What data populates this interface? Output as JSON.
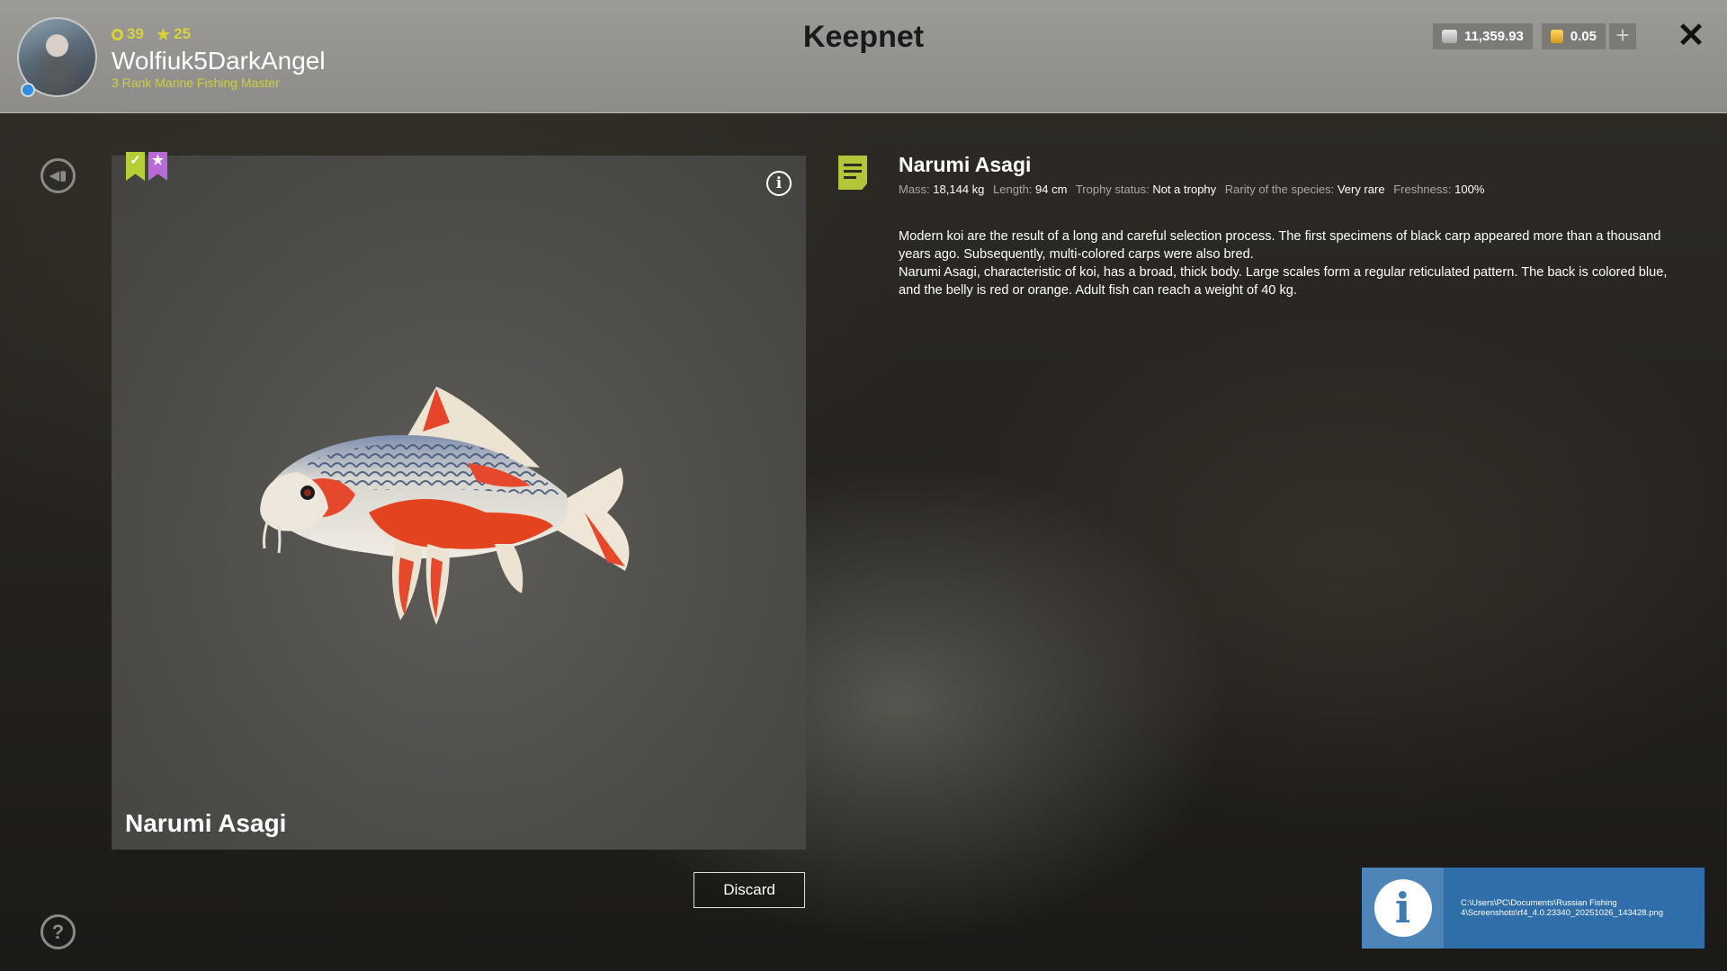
{
  "header": {
    "title": "Keepnet",
    "player": {
      "level": "39",
      "stars": "25",
      "username": "Wolfiuk5DarkAngel",
      "rank": "3 Rank Marine Fishing Master"
    },
    "currency": {
      "silver": "11,359.93",
      "gold": "0.05",
      "silver_icon": "silver-coins-icon",
      "gold_icon": "gold-coins-icon"
    },
    "add_label": "+",
    "close_label": "✕"
  },
  "fish": {
    "name": "Narumi Asagi",
    "flags": [
      "checked-flag-icon",
      "starred-flag-icon"
    ],
    "stats": {
      "mass_label": "Mass:",
      "mass": "18,144 kg",
      "length_label": "Length:",
      "length": "94 cm",
      "trophy_label": "Trophy status:",
      "trophy": "Not a trophy",
      "rarity_label": "Rarity of the species:",
      "rarity": "Very rare",
      "freshness_label": "Freshness:",
      "freshness": "100%"
    },
    "description": [
      "Modern koi are the result of a long and careful selection process. The first specimens of black carp appeared more than a thousand years ago. Subsequently, multi-colored carps were also bred.",
      "Narumi Asagi, characteristic of koi, has a broad, thick body. Large scales form a regular reticulated pattern. The back is colored blue, and the belly is red or orange. Adult fish can reach a weight of 40 kg."
    ]
  },
  "actions": {
    "discard": "Discard"
  },
  "notification": {
    "text": "C:\\Users\\PC\\Documents\\Russian Fishing 4\\Screenshots\\rf4_4.0.23340_20251026_143428.png"
  },
  "colors": {
    "accent_green": "#b3c63a",
    "accent_yellow": "#d9d33a",
    "flag_purple": "#b96ad8",
    "notify_blue": "#2f6ea8"
  }
}
